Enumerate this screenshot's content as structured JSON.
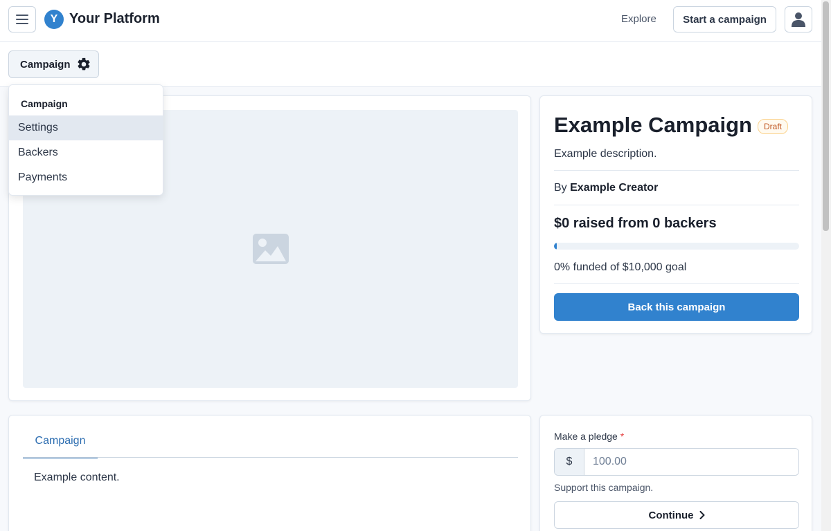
{
  "header": {
    "logo_letter": "Y",
    "brand": "Your Platform",
    "explore": "Explore",
    "start_campaign": "Start a campaign"
  },
  "subbar": {
    "campaign_menu_label": "Campaign"
  },
  "dropdown": {
    "header": "Campaign",
    "items": [
      {
        "label": "Settings",
        "active": true
      },
      {
        "label": "Backers",
        "active": false
      },
      {
        "label": "Payments",
        "active": false
      }
    ]
  },
  "campaign": {
    "title": "Example Campaign",
    "status_badge": "Draft",
    "description": "Example description.",
    "by_prefix": "By",
    "creator": "Example Creator",
    "raised_summary": "$0 raised from 0 backers",
    "progress_percent": 0,
    "funded_text": "0% funded of $10,000 goal",
    "back_button": "Back this campaign"
  },
  "content": {
    "tab": "Campaign",
    "body": "Example content."
  },
  "pledge": {
    "label": "Make a pledge",
    "required_marker": "*",
    "currency": "$",
    "placeholder": "100.00",
    "help": "Support this campaign.",
    "continue": "Continue"
  },
  "colors": {
    "accent": "#3182ce",
    "draft_badge": "#c05621",
    "required": "#e53e3e"
  }
}
